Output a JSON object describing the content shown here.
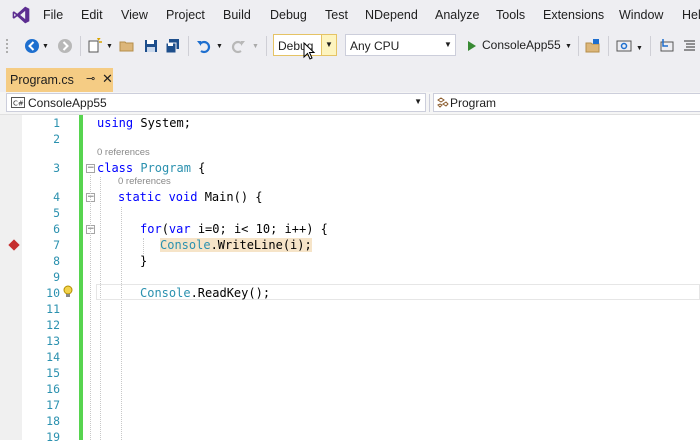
{
  "menubar": {
    "items": [
      "File",
      "Edit",
      "View",
      "Project",
      "Build",
      "Debug",
      "Test",
      "NDepend",
      "Analyze",
      "Tools",
      "Extensions",
      "Window",
      "Help"
    ]
  },
  "toolbar": {
    "config_value": "Debug",
    "platform_value": "Any CPU",
    "run_target": "ConsoleApp55"
  },
  "tab": {
    "label": "Program.cs",
    "pin_icon": "pin-icon",
    "close_icon": "close-icon"
  },
  "navbar": {
    "project": "ConsoleApp55",
    "type": "Program"
  },
  "editor": {
    "line_numbers": [
      "1",
      "2",
      "3",
      "4",
      "5",
      "6",
      "7",
      "8",
      "9",
      "10",
      "11",
      "12",
      "13",
      "14",
      "15",
      "16",
      "17",
      "18",
      "19"
    ],
    "references_class": "0 references",
    "references_method": "0 references",
    "breakpoint_line": "7",
    "code": {
      "l1_kw": "using",
      "l1_rest": " System;",
      "l3_kw": "class",
      "l3_type": "Program",
      "l3_rest": " {",
      "l4_kw": "static void",
      "l4_rest": " Main() {",
      "l6_kw": "for",
      "l6_paren": "(",
      "l6_kw2": "var",
      "l6_rest": " i=0; i< 10; i++) {",
      "l7_type": "Console",
      "l7_rest": ".WriteLine(i);",
      "l8": "}",
      "l10_type": "Console",
      "l10_rest": ".ReadKey();"
    }
  },
  "colors": {
    "accent_tab": "#f5cc84",
    "change_bar": "#57d44f",
    "breakpoint": "#c52d2d",
    "keyword": "#0000ff",
    "type": "#2b91af"
  }
}
